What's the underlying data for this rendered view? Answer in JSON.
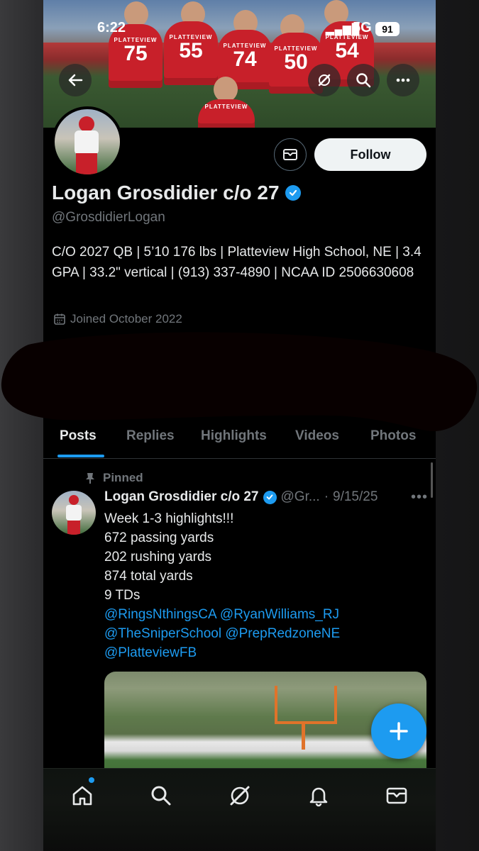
{
  "status_bar": {
    "time": "6:22",
    "network": "5G",
    "battery": "91"
  },
  "banner": {
    "players": [
      {
        "team": "PLATTEVIEW",
        "number": "75"
      },
      {
        "team": "PLATTEVIEW",
        "number": "55"
      },
      {
        "team": "PLATTEVIEW",
        "number": "74"
      },
      {
        "team": "PLATTEVIEW",
        "number": "50"
      },
      {
        "team": "PLATTEVIEW",
        "number": "54"
      }
    ],
    "kneeling_team": "PLATTEVIEW"
  },
  "profile": {
    "name": "Logan Grosdidier c/o 27",
    "handle": "@GrosdidierLogan",
    "bio": "C/O 2027 QB | 5’10 176 lbs | Platteview High School, NE | 3.4 GPA | 33.2\" vertical | (913) 337-4890 | NCAA ID 2506630608",
    "joined": "Joined October 2022",
    "follow_label": "Follow"
  },
  "tabs": [
    {
      "label": "Posts",
      "active": true
    },
    {
      "label": "Replies",
      "active": false
    },
    {
      "label": "Highlights",
      "active": false
    },
    {
      "label": "Videos",
      "active": false
    },
    {
      "label": "Photos",
      "active": false
    }
  ],
  "post": {
    "pinned_label": "Pinned",
    "author": "Logan Grosdidier c/o 27",
    "handle_trunc": "@Gr...",
    "date": "9/15/25",
    "lines": [
      "Week 1-3 highlights!!!",
      "672 passing yards",
      "202 rushing yards",
      "874 total yards",
      "9 TDs"
    ],
    "mentions_line1": "@RingsNthingsCA @RyanWilliams_RJ",
    "mentions_line2": "@TheSniperSchool @PrepRedzoneNE",
    "mentions_line3": "@PlatteviewFB"
  },
  "colors": {
    "accent": "#1d9bf0",
    "background": "#000000",
    "text": "#e7e9ea",
    "muted": "#71767b"
  }
}
